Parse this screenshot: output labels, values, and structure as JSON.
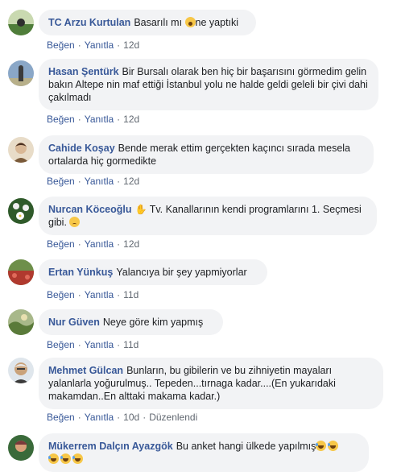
{
  "comments": [
    {
      "author": "TC Arzu Kurtulan",
      "text_before": "Basarılı mı",
      "text_after": "ne yaptıki",
      "like": "Beğen",
      "reply": "Yanıtla",
      "time": "12d",
      "avatar_colors": [
        "#4f7d3a",
        "#c9d9b0"
      ]
    },
    {
      "author": "Hasan Şentürk",
      "text": "Bir Bursalı olarak ben hiç bir başarısını görmedim gelin bakın Altepe nin maf ettiği İstanbul yolu ne halde geldi geleli bir çivi dahi çakılmadı",
      "like": "Beğen",
      "reply": "Yanıtla",
      "time": "12d",
      "avatar_colors": [
        "#8aa7c7",
        "#3b3b3b"
      ]
    },
    {
      "author": "Cahide Koşay",
      "text": "Bende merak ettim gerçekten kaçıncı sırada mesela ortalarda hiç gormedikte",
      "like": "Beğen",
      "reply": "Yanıtla",
      "time": "12d",
      "avatar_colors": [
        "#d9c9b3",
        "#7a5a3a"
      ]
    },
    {
      "author": "Nurcan Köceoğlu",
      "text_before": "Tv. Kanallarının kendi programlarını 1. Seçmesi gibi.",
      "like": "Beğen",
      "reply": "Yanıtla",
      "time": "12d",
      "avatar_colors": [
        "#2f5a2a",
        "#e6e6e6"
      ]
    },
    {
      "author": "Ertan Yünkuş",
      "text": "Yalancıya bir şey yapmiyorlar",
      "like": "Beğen",
      "reply": "Yanıtla",
      "time": "11d",
      "avatar_colors": [
        "#b0392e",
        "#6e8f4a"
      ]
    },
    {
      "author": "Nur Güven",
      "text": "Neye göre kim yapmış",
      "like": "Beğen",
      "reply": "Yanıtla",
      "time": "11d",
      "avatar_colors": [
        "#5a7a3a",
        "#a8b88a"
      ]
    },
    {
      "author": "Mehmet Gülcan",
      "text": "Bunların, bu gibilerin ve bu zihniyetin mayaları yalanlarla yoğurulmuş.. Tepeden...tırnaga kadar....(En yukarıdaki makamdan..En alttaki makama kadar.)",
      "like": "Beğen",
      "reply": "Yanıtla",
      "time": "10d",
      "edited": "Düzenlendi",
      "avatar_colors": [
        "#c9a27a",
        "#3a3a3a"
      ]
    },
    {
      "author": "Mükerrem Dalçın Ayazgök",
      "text": "Bu anket hangi ülkede yapılmış",
      "avatar_colors": [
        "#7a3a3a",
        "#3a6a3a"
      ]
    }
  ]
}
